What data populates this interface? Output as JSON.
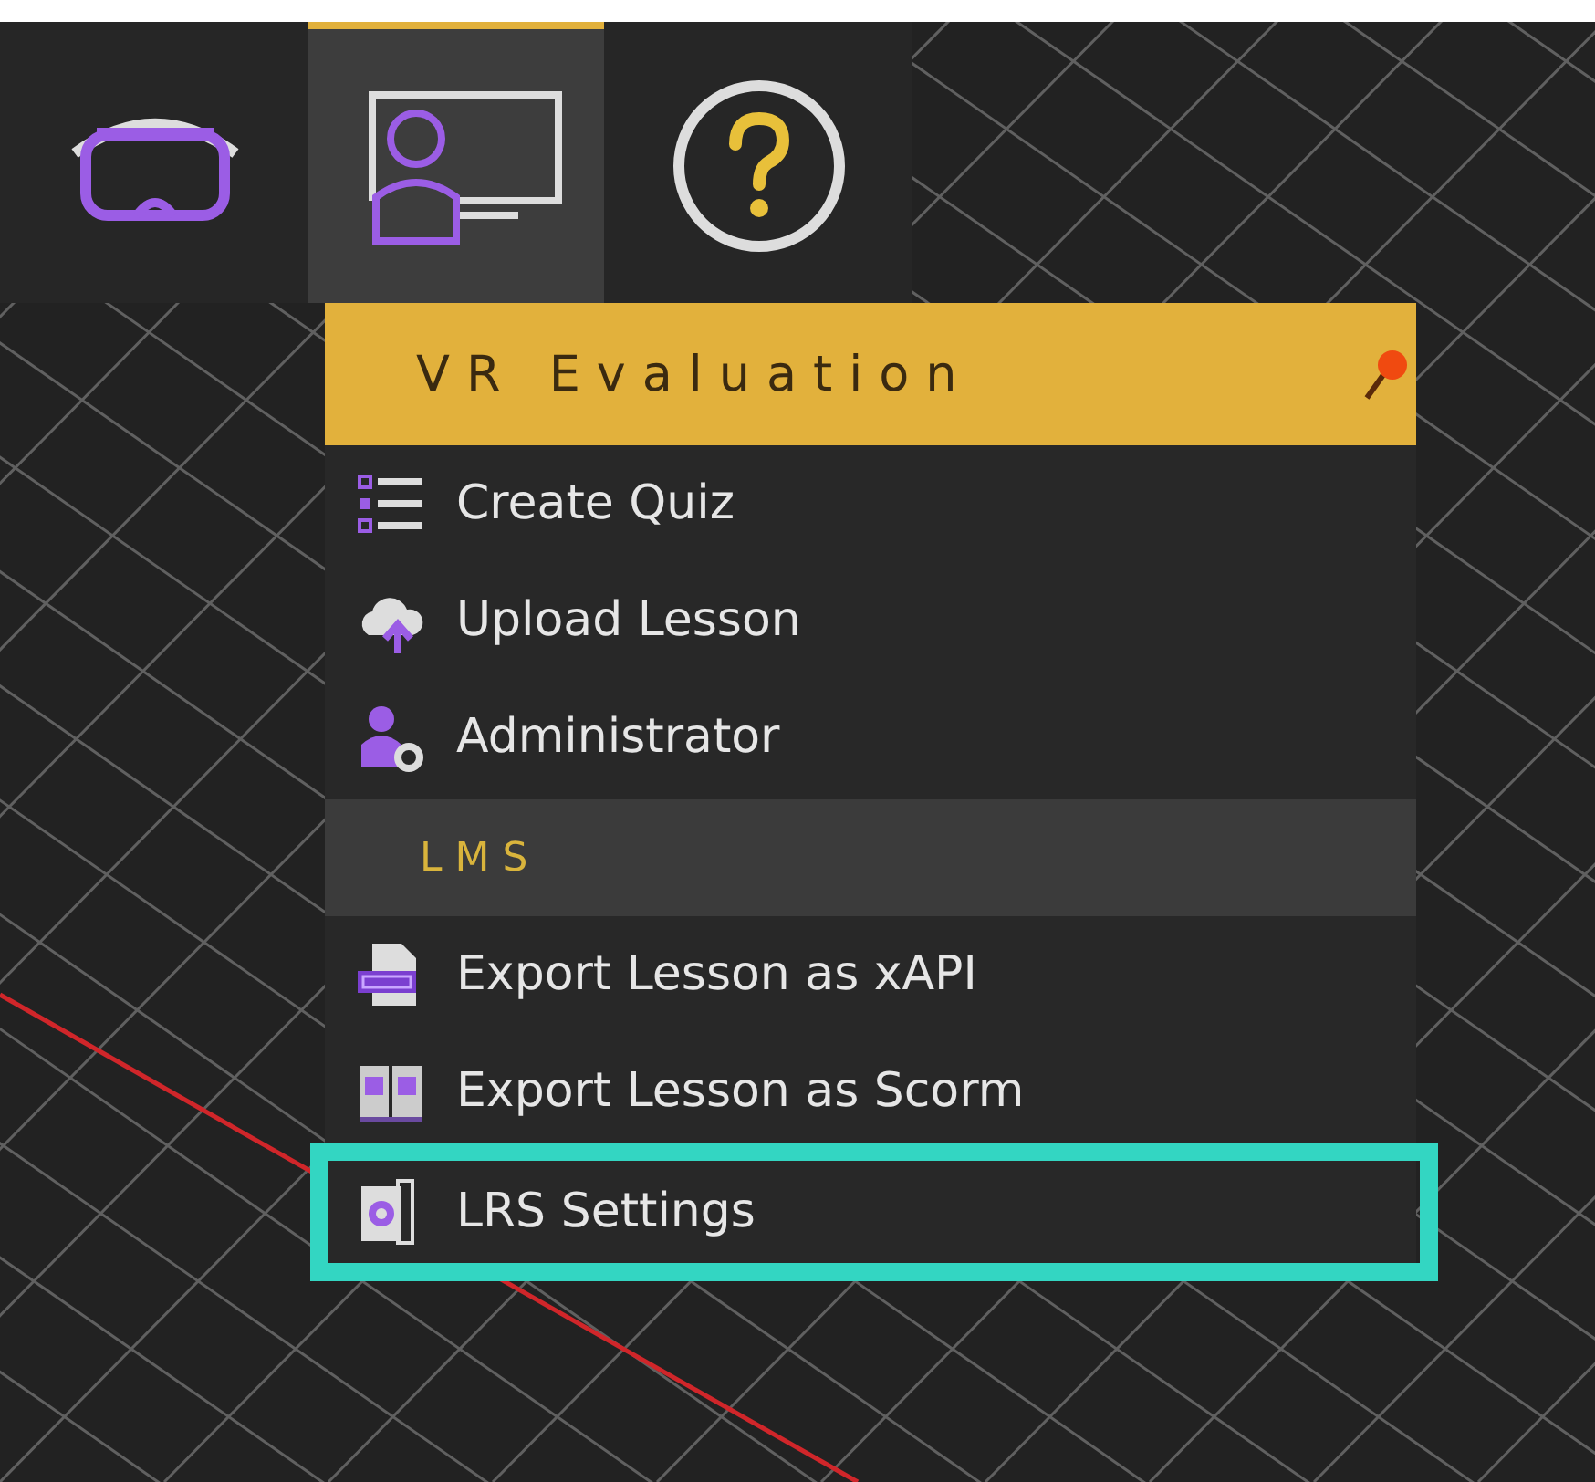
{
  "toolbar": [
    {
      "kind": "headset",
      "selected": false
    },
    {
      "kind": "presenter",
      "selected": true
    },
    {
      "kind": "help",
      "selected": false
    }
  ],
  "menu": {
    "title": "VR Evaluation",
    "groups": [
      {
        "items": [
          {
            "kind": "quiz",
            "label": "Create Quiz",
            "highlighted": false
          },
          {
            "kind": "upload",
            "label": "Upload Lesson",
            "highlighted": false
          },
          {
            "kind": "admin",
            "label": "Administrator",
            "highlighted": false
          }
        ]
      },
      {
        "heading": "L M S",
        "items": [
          {
            "kind": "xapi",
            "label": "Export Lesson as xAPI",
            "highlighted": false
          },
          {
            "kind": "scorm",
            "label": "Export Lesson as Scorm",
            "highlighted": false
          },
          {
            "kind": "lrs",
            "label": "LRS Settings",
            "highlighted": true
          }
        ]
      }
    ]
  }
}
